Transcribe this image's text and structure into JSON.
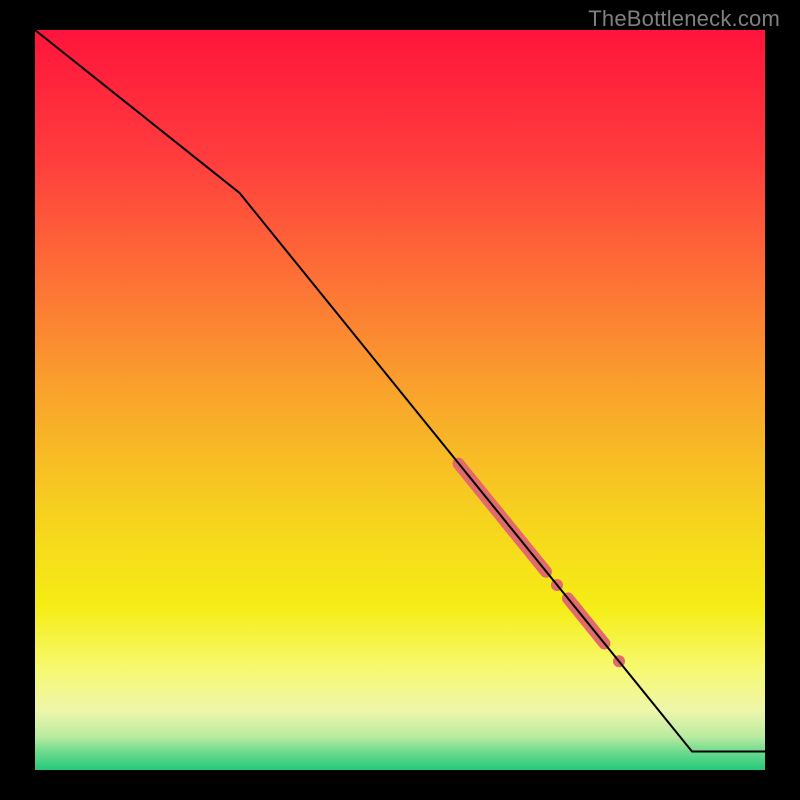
{
  "watermark": "TheBottleneck.com",
  "gradient": {
    "stops": [
      {
        "offset": 0.0,
        "color": "#ff143c"
      },
      {
        "offset": 0.18,
        "color": "#ff3f3d"
      },
      {
        "offset": 0.34,
        "color": "#fd7236"
      },
      {
        "offset": 0.5,
        "color": "#f9a62b"
      },
      {
        "offset": 0.66,
        "color": "#f6d31e"
      },
      {
        "offset": 0.78,
        "color": "#f5ed15"
      },
      {
        "offset": 0.86,
        "color": "#f7f96d"
      },
      {
        "offset": 0.92,
        "color": "#eef6ab"
      },
      {
        "offset": 0.955,
        "color": "#b9eba1"
      },
      {
        "offset": 0.975,
        "color": "#6fdb8f"
      },
      {
        "offset": 1.0,
        "color": "#24c97a"
      }
    ]
  },
  "chart_data": {
    "type": "line",
    "title": "",
    "xlabel": "",
    "ylabel": "",
    "xlim": [
      0,
      100
    ],
    "ylim": [
      0,
      100
    ],
    "grid": false,
    "series": [
      {
        "name": "bottleneck-curve",
        "points": [
          {
            "x": 0,
            "y": 100
          },
          {
            "x": 28,
            "y": 78
          },
          {
            "x": 90,
            "y": 2.5
          },
          {
            "x": 100,
            "y": 2.5
          }
        ],
        "color": "#000000",
        "width": 2
      }
    ],
    "highlight_segments": [
      {
        "name": "segment-a",
        "x0": 58,
        "y0": 41.4,
        "x1": 70,
        "y1": 26.8,
        "color": "#e2696c",
        "width": 12
      },
      {
        "name": "segment-b",
        "x0": 73,
        "y0": 23.2,
        "x1": 78,
        "y1": 17.1,
        "color": "#e2696c",
        "width": 12
      }
    ],
    "highlight_dots": [
      {
        "name": "dot-a",
        "x": 71.5,
        "y": 25.0,
        "r": 6,
        "color": "#e2696c"
      },
      {
        "name": "dot-b",
        "x": 80.0,
        "y": 14.7,
        "r": 6,
        "color": "#e2696c"
      }
    ]
  }
}
